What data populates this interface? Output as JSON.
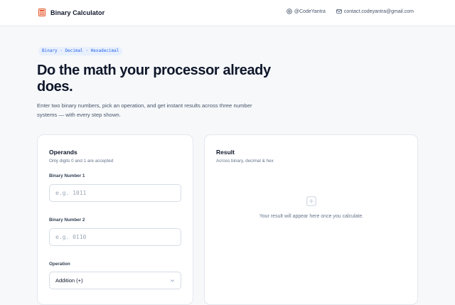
{
  "header": {
    "brand_title": "Binary Calculator",
    "logo_icon": "calculator-grid-icon",
    "links": [
      {
        "icon": "at-sign-icon",
        "label": "@CodeYantra"
      },
      {
        "icon": "mail-icon",
        "label": "contact.codeyantra@gmail.com"
      }
    ]
  },
  "hero": {
    "pill": "Binary · Decimal · Hexadecimal",
    "title": "Do the math your processor already does.",
    "subtitle": "Enter two binary numbers, pick an operation, and get instant results across three number systems — with every step shown."
  },
  "operands": {
    "title": "Operands",
    "subtitle": "Only digits 0 and 1 are accepted",
    "binary1": {
      "label": "Binary Number 1",
      "placeholder": "e.g. 1011",
      "value": ""
    },
    "binary2": {
      "label": "Binary Number 2",
      "placeholder": "e.g. 0110",
      "value": ""
    },
    "operation": {
      "label": "Operation",
      "selected": "Addition (+)"
    }
  },
  "result": {
    "title": "Result",
    "subtitle": "Across binary, decimal & hex",
    "empty_icon": "plus-square-icon",
    "empty_message": "Your result will appear here once you calculate."
  },
  "colors": {
    "accent": "#2563eb",
    "pill_background": "#e8f0fd",
    "page_background": "#f6f8fa",
    "text_primary": "#0f172a",
    "text_muted": "#64748b"
  }
}
